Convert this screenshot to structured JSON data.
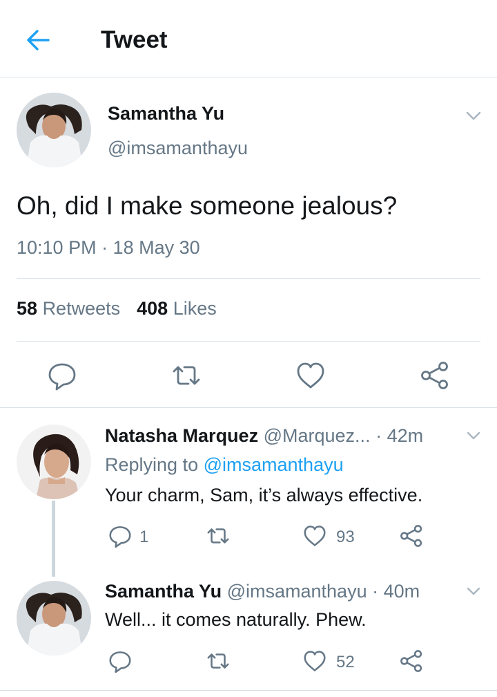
{
  "header": {
    "title": "Tweet",
    "back_icon": "arrow-left-icon",
    "accent": "#1da1f2"
  },
  "tweet": {
    "author_name": "Samantha Yu",
    "author_handle": "@imsamanthayu",
    "text": "Oh, did I make someone jealous?",
    "timestamp": "10:10 PM · 18 May 30",
    "retweets_count": "58",
    "retweets_label": "Retweets",
    "likes_count": "408",
    "likes_label": "Likes",
    "actions": [
      "reply-icon",
      "retweet-icon",
      "heart-icon",
      "share-icon"
    ]
  },
  "replies": [
    {
      "author_name": "Natasha Marquez",
      "author_handle": "@Marquez...",
      "time": "· 42m",
      "replying_label": "Replying to",
      "replying_handle": "@imsamanthayu",
      "text": "Your charm, Sam, it’s always effective.",
      "reply_count": "1",
      "like_count": "93"
    },
    {
      "author_name": "Samantha Yu",
      "author_handle": "@imsamanthayu",
      "time": "· 40m",
      "text": "Well... it comes naturally. Phew.",
      "reply_count": "",
      "like_count": "52"
    }
  ]
}
